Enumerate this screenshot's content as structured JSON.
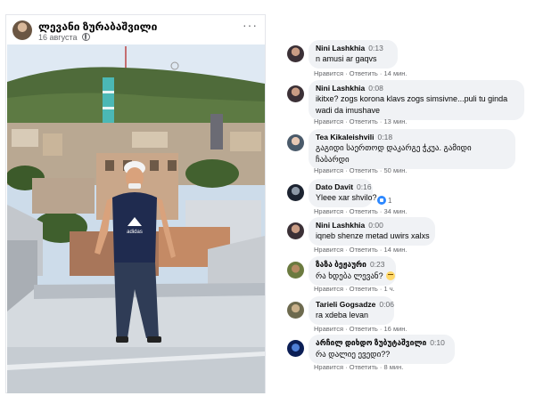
{
  "post": {
    "author": "ლევანი ზურაბაშვილი",
    "date": "16 августа",
    "more_icon": "more-dots-icon",
    "privacy_icon": "globe-icon",
    "photo_description_icon": "photo"
  },
  "comments": [
    {
      "name": "Nini Lashkhia",
      "time": "0:13",
      "text_lines": [
        "n amusi ar gaqvs"
      ],
      "actions": {
        "like": "Нравится",
        "reply": "Ответить",
        "ago": "14 мин."
      }
    },
    {
      "name": "Nini Lashkhia",
      "time": "0:08",
      "text_lines": [
        "ikitxe? zogs korona klavs zogs simsivne...puli tu ginda",
        "wadi da imushave"
      ],
      "actions": {
        "like": "Нравится",
        "reply": "Ответить",
        "ago": "13 мин."
      }
    },
    {
      "name": "Tea Kikaleishvili",
      "time": "0:18",
      "text_lines": [
        "გაგიდი საერთოდ დაკარგე ჭკუა. გამიდი",
        "ჩაბარდი"
      ],
      "actions": {
        "like": "Нравится",
        "reply": "Ответить",
        "ago": "50 мин."
      }
    },
    {
      "name": "Dato Davit",
      "time": "0:16",
      "text_lines": [
        "Yleee xar shvilo?"
      ],
      "reaction_count": "1",
      "actions": {
        "like": "Нравится",
        "reply": "Ответить",
        "ago": "34 мин."
      }
    },
    {
      "name": "Nini Lashkhia",
      "time": "0:00",
      "text_lines": [
        "iqneb shenze metad uwirs xalxs"
      ],
      "actions": {
        "like": "Нравится",
        "reply": "Ответить",
        "ago": "14 мин."
      }
    },
    {
      "name": "ზაზა ბეჟაური",
      "time": "0:23",
      "text_lines": [
        "რა ხდება ლევან?"
      ],
      "actions": {
        "like": "Нравится",
        "reply": "Ответить",
        "ago": "1 ч."
      }
    },
    {
      "name": "Tarieli Gogsadze",
      "time": "0:06",
      "text_lines": [
        "ra xdeba levan"
      ],
      "actions": {
        "like": "Нравится",
        "reply": "Ответить",
        "ago": "16 мин."
      }
    },
    {
      "name": "არჩილ დიხდო ზუბუტაშვილი",
      "time": "0:10",
      "text_lines": [
        "რა დალიე ევედი??"
      ],
      "actions": {
        "like": "Нравится",
        "reply": "Ответить",
        "ago": "8 мин."
      }
    }
  ],
  "colors": {
    "bubble_bg": "#f0f2f5",
    "meta_text": "#65676b",
    "name_text": "#050505"
  }
}
